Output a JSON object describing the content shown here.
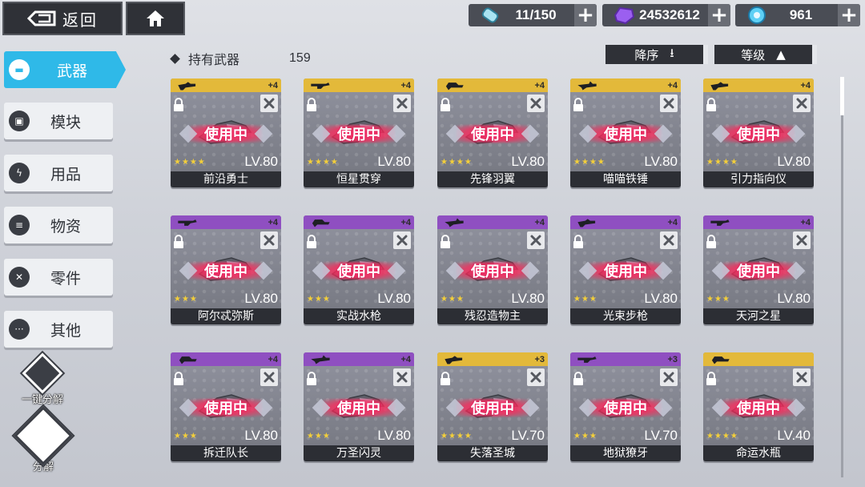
{
  "topbar": {
    "back_label": "返回",
    "resources": [
      {
        "icon": "energy-capsule-icon",
        "value": "11/150"
      },
      {
        "icon": "purple-crystal-icon",
        "value": "24532612"
      },
      {
        "icon": "blue-gem-icon",
        "value": "961"
      }
    ]
  },
  "sidebar": {
    "items": [
      {
        "label": "武器",
        "icon": "weapon-icon",
        "active": true
      },
      {
        "label": "模块",
        "icon": "module-icon"
      },
      {
        "label": "用品",
        "icon": "lightning-icon"
      },
      {
        "label": "物资",
        "icon": "supplies-icon"
      },
      {
        "label": "零件",
        "icon": "parts-icon"
      },
      {
        "label": "其他",
        "icon": "more-icon"
      }
    ],
    "quick_decompose_label": "一键分解",
    "decompose_label": "分解"
  },
  "header": {
    "title": "持有武器",
    "count": "159",
    "sort_desc_label": "降序",
    "sort_level_label": "等级"
  },
  "colors": {
    "accent": "#2fb9e8",
    "gold_rarity": "#e3b93a",
    "purple_rarity": "#8f4fc1",
    "in_use_glow": "#ff2f6e",
    "star": "#f3cf3a"
  },
  "in_use_label": "使用中",
  "weapons": [
    {
      "name": "前沿勇士",
      "level": "LV.80",
      "plus": "+4",
      "stars": "★★★★",
      "rarity": "gold"
    },
    {
      "name": "恒星贯穿",
      "level": "LV.80",
      "plus": "+4",
      "stars": "★★★★",
      "rarity": "gold"
    },
    {
      "name": "先锋羽翼",
      "level": "LV.80",
      "plus": "+4",
      "stars": "★★★★",
      "rarity": "gold"
    },
    {
      "name": "喵喵铁锤",
      "level": "LV.80",
      "plus": "+4",
      "stars": "★★★★",
      "rarity": "gold"
    },
    {
      "name": "引力指向仪",
      "level": "LV.80",
      "plus": "+4",
      "stars": "★★★★",
      "rarity": "gold"
    },
    {
      "name": "阿尔忒弥斯",
      "level": "LV.80",
      "plus": "+4",
      "stars": "★★★",
      "rarity": "purple"
    },
    {
      "name": "实战水枪",
      "level": "LV.80",
      "plus": "+4",
      "stars": "★★★",
      "rarity": "purple"
    },
    {
      "name": "残忍造物主",
      "level": "LV.80",
      "plus": "+4",
      "stars": "★★★",
      "rarity": "purple"
    },
    {
      "name": "光束步枪",
      "level": "LV.80",
      "plus": "+4",
      "stars": "★★★",
      "rarity": "purple"
    },
    {
      "name": "天河之星",
      "level": "LV.80",
      "plus": "+4",
      "stars": "★★★",
      "rarity": "purple"
    },
    {
      "name": "拆迁队长",
      "level": "LV.80",
      "plus": "+4",
      "stars": "★★★",
      "rarity": "purple"
    },
    {
      "name": "万圣闪灵",
      "level": "LV.80",
      "plus": "+4",
      "stars": "★★★",
      "rarity": "purple"
    },
    {
      "name": "失落圣城",
      "level": "LV.70",
      "plus": "+3",
      "stars": "★★★★",
      "rarity": "gold"
    },
    {
      "name": "地狱獠牙",
      "level": "LV.70",
      "plus": "+3",
      "stars": "★★★",
      "rarity": "purple"
    },
    {
      "name": "命运水瓶",
      "level": "LV.40",
      "plus": "",
      "stars": "★★★★",
      "rarity": "gold"
    }
  ]
}
